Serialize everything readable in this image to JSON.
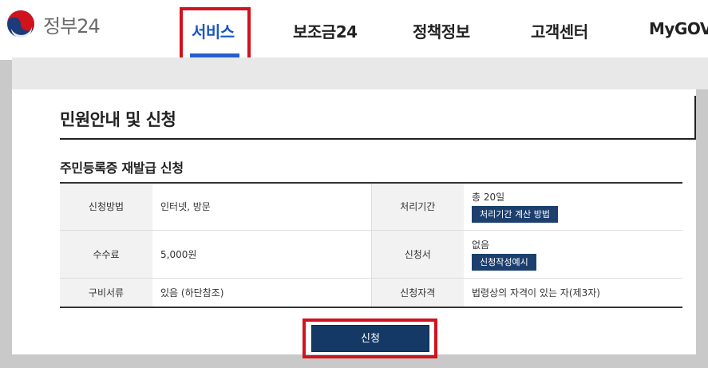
{
  "header": {
    "logo_text": "정부24",
    "nav": [
      {
        "label": "서비스",
        "active": true
      },
      {
        "label": "보조금24",
        "active": false
      },
      {
        "label": "정책정보",
        "active": false
      },
      {
        "label": "고객센터",
        "active": false
      },
      {
        "label": "MyGOV",
        "active": false
      }
    ]
  },
  "panel": {
    "title": "민원안내 및 신청",
    "section_title": "주민등록증 재발급 신청"
  },
  "table": {
    "rows": [
      {
        "label1": "신청방법",
        "value1": "인터넷, 방문",
        "label2": "처리기간",
        "value2": "총 20일",
        "button2": "처리기간 계산 방법"
      },
      {
        "label1": "수수료",
        "value1": "5,000원",
        "label2": "신청서",
        "value2": "없음",
        "button2": "신청작성예시"
      },
      {
        "label1": "구비서류",
        "value1": "있음 (하단참조)",
        "label2": "신청자격",
        "value2": "법령상의 자격이 있는 자(제3자)"
      }
    ]
  },
  "apply_button": "신청",
  "colors": {
    "highlight": "#d1131d",
    "active_nav": "#1a56c4",
    "button_navy": "#153965"
  }
}
